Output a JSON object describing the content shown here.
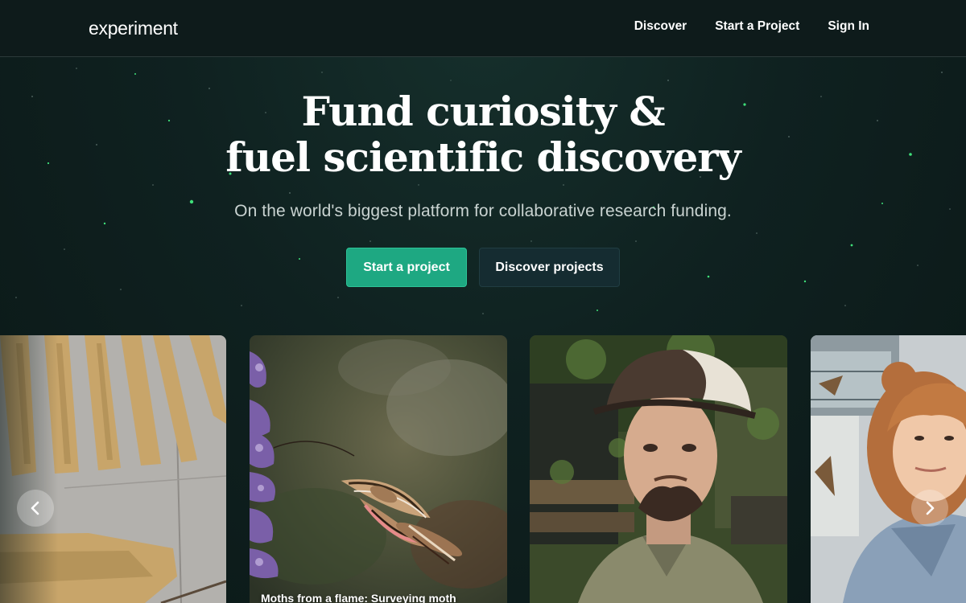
{
  "header": {
    "logo": "experiment",
    "nav": [
      {
        "label": "Discover"
      },
      {
        "label": "Start a Project"
      },
      {
        "label": "Sign In"
      }
    ]
  },
  "hero": {
    "title_line1": "Fund curiosity &",
    "title_line2": "fuel scientific discovery",
    "subtitle": "On the world's biggest platform for collaborative research funding.",
    "primary_button": "Start a project",
    "secondary_button": "Discover projects"
  },
  "carousel": {
    "cards": [
      {
        "caption": "",
        "image": "grain-drying-photo"
      },
      {
        "caption": "Moths from a flame: Surveying moth",
        "image": "hawk-moth-photo"
      },
      {
        "caption": "",
        "image": "researcher-man-photo"
      },
      {
        "caption": "",
        "image": "researcher-woman-photo"
      }
    ],
    "prev_icon": "chevron-left-icon",
    "next_icon": "chevron-right-icon"
  },
  "colors": {
    "background": "#0d1a1a",
    "accent": "#1ea882",
    "secondary_button": "#152c31",
    "star_green": "#2fd66b"
  }
}
